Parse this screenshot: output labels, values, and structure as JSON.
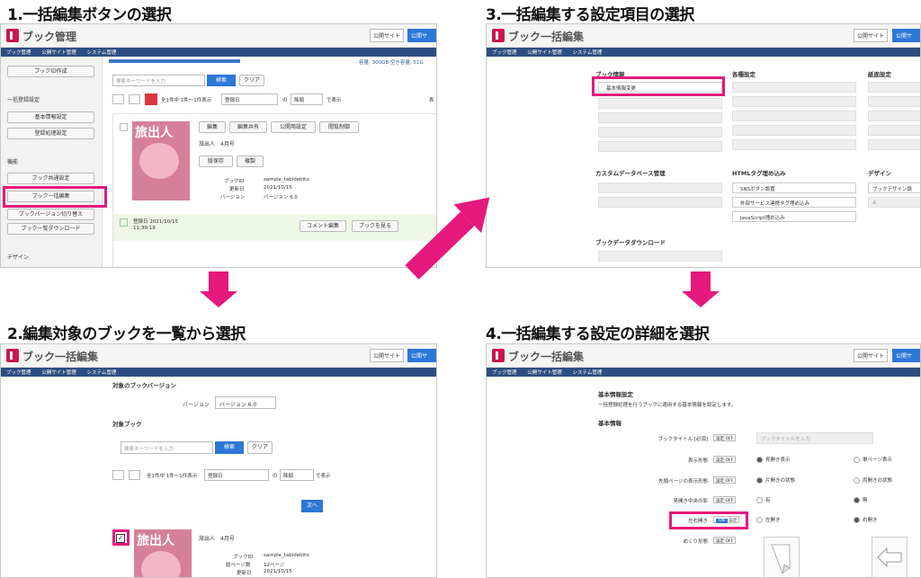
{
  "steps": {
    "s1": "1.一括編集ボタンの選択",
    "s2": "2.編集対象のブックを一覧から選択",
    "s3": "3.一括編集する設定項目の選択",
    "s4": "4.一括編集する設定の詳細を選択"
  },
  "common": {
    "site_select": "公開サイト",
    "publish_btn": "公開サ",
    "nav": [
      "ブック管理",
      "公開サイト管理",
      "システム管理"
    ]
  },
  "p1": {
    "app_title": "ブック管理",
    "storage": "容量: 300GB 空き容量: 51G",
    "sidebar": {
      "create": "ブックID作成",
      "bulk_reg": "一括登録設定",
      "basic_info": "基本情報設定",
      "reg_process": "登録処理設定",
      "func": "機能",
      "shared": "ブック共通設定",
      "bulk_edit": "ブック一括編集",
      "version": "ブックバージョン切り替え",
      "download": "ブック一覧ダウンロード",
      "design": "デザイン"
    },
    "search_placeholder": "検索キーワードを入力",
    "search_btn": "検索",
    "clear_btn": "クリア",
    "count": "全1件中 1件〜1件表示",
    "sort": "登録日",
    "no": "の",
    "order": "降順",
    "display": "で表示",
    "disp_trunc": "表",
    "book_btns": [
      "編集",
      "編集共有",
      "公開用設定",
      "閲覧制御"
    ],
    "book_name": "旅出人　4月号",
    "save_btn": "版保存",
    "copy_btn": "複製",
    "id_label": "ブックID",
    "id_value": "sample_tabidebito",
    "updated_label": "更新日",
    "updated_value": "2021/10/15",
    "ver_label": "バージョン",
    "ver_value": "バージョン 6.0",
    "reg_date": "登録日 2021/10/15",
    "reg_time": "11:39:19",
    "comment_btn": "コメント編集",
    "view_btn": "ブックを見る",
    "cover_title": "旅出人"
  },
  "p2": {
    "app_title": "ブック一括編集",
    "target_version": "対象のブックバージョン",
    "version_label": "バージョン",
    "version_value": "バージョン 6.0",
    "target_book": "対象ブック",
    "search_placeholder": "検索キーワードを入力",
    "search_btn": "検索",
    "clear_btn": "クリア",
    "count": "全1件中 1件〜1件表示",
    "sort": "登録日",
    "no": "の",
    "order": "降順",
    "display": "で表示",
    "next_btn": "次へ",
    "book_name": "旅出人　4月号",
    "id_label": "ブックID",
    "id_value": "sample_tabidebito",
    "pages_label": "総ページ数",
    "pages_value": "12ページ",
    "updated_label": "更新日",
    "updated_value": "2021/10/15",
    "cover_title": "旅出人"
  },
  "p3": {
    "app_title": "ブック一括編集",
    "book_info": "ブック情報",
    "basic_change": "基本情報変更",
    "various": "各種設定",
    "paper": "紙面設定",
    "custom_db": "カスタムデータベース管理",
    "html_tag": "HTMLタグ埋め込み",
    "sns": "SNSボタン設置",
    "external": "外部サービス連携タグ埋め込み",
    "js": "JavaScript埋め込み",
    "design": "デザイン",
    "design_setting": "ブックデザイン設",
    "book_data_dl": "ブックデータダウンロード",
    "design_icon": "▲"
  },
  "p4": {
    "app_title": "ブック一括編集",
    "h1": "基本情報設定",
    "desc": "一括登録処理を行うブックに適用する基本情報を設定します。",
    "h2": "基本情報",
    "rows": {
      "title": "ブックタイトル [必須]",
      "title_ph": "ブックタイトルを入力",
      "display": "表示形態",
      "display_a": "見開き表示",
      "display_b": "単ページ表示",
      "first": "先頭ページの表示形態",
      "first_a": "片開きの状態",
      "first_b": "両開きの状態",
      "shadow": "見開き中央の影",
      "shadow_a": "有",
      "shadow_b": "無",
      "direction": "左右開き",
      "dir_a": "左開き",
      "dir_b": "右開き",
      "flip": "めくり形態"
    },
    "setting": "設定",
    "off": "OFF",
    "on": "ON"
  }
}
